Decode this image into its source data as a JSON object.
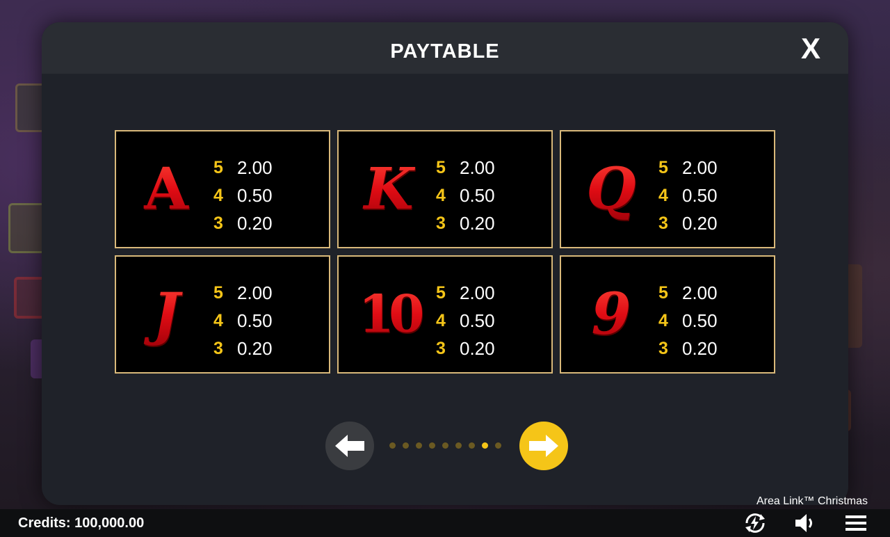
{
  "modal": {
    "title": "PAYTABLE",
    "close_label": "X"
  },
  "symbols": [
    {
      "symbol": "A",
      "pays": [
        {
          "count": "5",
          "value": "2.00"
        },
        {
          "count": "4",
          "value": "0.50"
        },
        {
          "count": "3",
          "value": "0.20"
        }
      ]
    },
    {
      "symbol": "K",
      "pays": [
        {
          "count": "5",
          "value": "2.00"
        },
        {
          "count": "4",
          "value": "0.50"
        },
        {
          "count": "3",
          "value": "0.20"
        }
      ]
    },
    {
      "symbol": "Q",
      "pays": [
        {
          "count": "5",
          "value": "2.00"
        },
        {
          "count": "4",
          "value": "0.50"
        },
        {
          "count": "3",
          "value": "0.20"
        }
      ]
    },
    {
      "symbol": "J",
      "pays": [
        {
          "count": "5",
          "value": "2.00"
        },
        {
          "count": "4",
          "value": "0.50"
        },
        {
          "count": "3",
          "value": "0.20"
        }
      ]
    },
    {
      "symbol": "10",
      "pays": [
        {
          "count": "5",
          "value": "2.00"
        },
        {
          "count": "4",
          "value": "0.50"
        },
        {
          "count": "3",
          "value": "0.20"
        }
      ]
    },
    {
      "symbol": "9",
      "pays": [
        {
          "count": "5",
          "value": "2.00"
        },
        {
          "count": "4",
          "value": "0.50"
        },
        {
          "count": "3",
          "value": "0.20"
        }
      ]
    }
  ],
  "pagination": {
    "total_pages": 9,
    "current_page": 8
  },
  "game_name": "Area Link™ Christmas",
  "status_bar": {
    "credits": "Credits: 100,000.00"
  },
  "icons": {
    "prev": "arrow-left-icon",
    "next": "arrow-right-icon",
    "turbo": "turbo-spin-icon",
    "sound": "speaker-icon",
    "menu": "hamburger-menu-icon"
  },
  "colors": {
    "accent": "#f5c518",
    "card_border": "#d9b97a",
    "symbol_red": "#e4121c",
    "panel": "#1f2229"
  }
}
